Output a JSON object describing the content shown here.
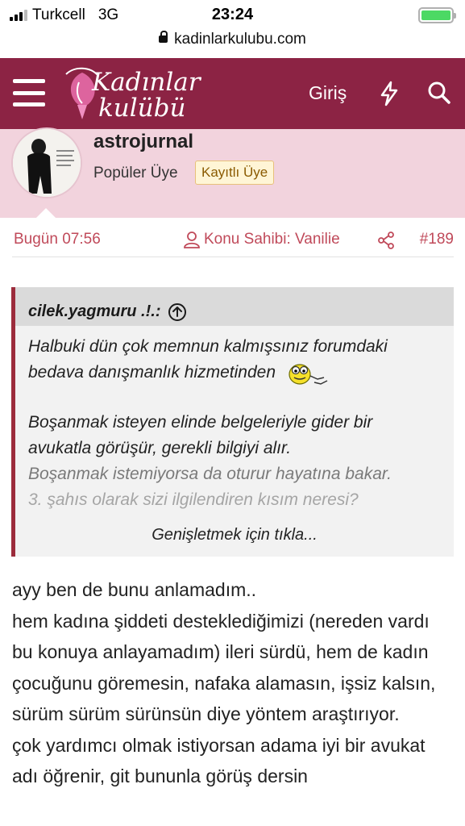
{
  "status": {
    "carrier": "Turkcell",
    "network": "3G",
    "time": "23:24",
    "battery_color": "#4cd964"
  },
  "browser": {
    "url": "kadinlarkulubu.com"
  },
  "nav": {
    "logo_line1": "Kadınlar",
    "logo_line2": "kulübü",
    "login_label": "Giriş",
    "icons": [
      "menu-icon",
      "bolt-icon",
      "search-icon"
    ],
    "bg_color": "#8c2344"
  },
  "user": {
    "name": "astrojurnal",
    "title": "Popüler Üye",
    "badge": "Kayıtlı Üye"
  },
  "meta": {
    "date": "Bugün 07:56",
    "owner": "Konu Sahibi: Vanilie",
    "post_number": "#189"
  },
  "quote": {
    "author": "cilek.yagmuru .!.:",
    "line1": "Halbuki dün çok memnun kalmışsınız forumdaki bedava danışmanlık hizmetinden",
    "line2": "Boşanmak isteyen elinde belgeleriyle gider bir avukatla görüşür, gerekli bilgiyi alır.",
    "line3": "Boşanmak istemiyorsa da oturur hayatına bakar.",
    "line4": "3. şahıs olarak sizi ilgilendiren kısım neresi?",
    "expand_label": "Genişletmek için tıkla..."
  },
  "post": {
    "p1": "ayy ben de bunu anlamadım..",
    "p2": "hem kadına şiddeti desteklediğimizi (nereden vardı bu konuya anlayamadım) ileri sürdü, hem de kadın çocuğunu göremesin, nafaka alamasın, işsiz kalsın, sürüm sürüm sürünsün diye yöntem araştırıyor.",
    "p3": "çok yardımcı olmak istiyorsan adama iyi bir avukat adı öğrenir, git bununla görüş dersin"
  }
}
